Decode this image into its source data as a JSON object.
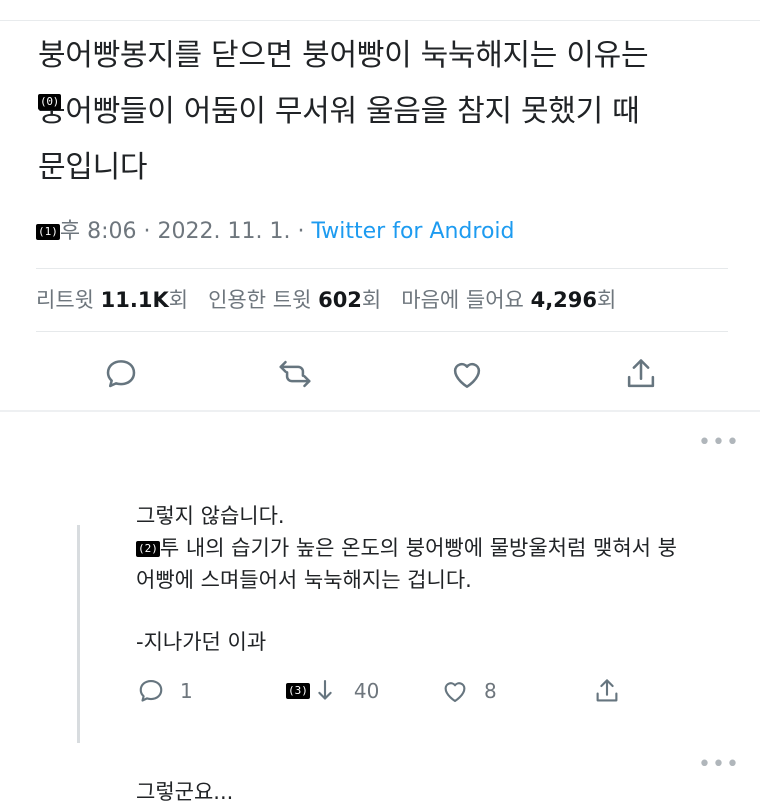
{
  "tweet": {
    "lines": [
      "붕어빵봉지를 닫으면 붕어빵이 눅눅해지는 이유는",
      "붕어빵들이 어둠이 무서워 울음을 참지 못했기 때",
      "문입니다"
    ],
    "marker0": "(0)",
    "marker1": "(1)",
    "time": "후 8:06",
    "date": "2022. 11. 1.",
    "via": "Twitter for Android",
    "stats": {
      "retweet_label": "리트윗",
      "retweet_count": "11.1K",
      "retweet_suffix": "회",
      "quote_label": "인용한 트윗",
      "quote_count": "602",
      "quote_suffix": "회",
      "like_label": "마음에 들어요",
      "like_count": "4,296",
      "like_suffix": "회"
    }
  },
  "actions": {
    "icons": [
      "reply-icon",
      "retweet-icon",
      "like-icon",
      "share-icon"
    ]
  },
  "reply": {
    "line1": "그렇지 않습니다.",
    "marker2": "(2)",
    "line2": "투 내의 습기가 높은 온도의 붕어빵에 물방울처럼 맺혀서 붕",
    "line3": "어빵에 스며들어서 눅눅해지는 겁니다.",
    "line4": "-지나가던 이과",
    "reply_count": "1",
    "marker3": "(3)",
    "retweet_count": "40",
    "like_count": "8"
  },
  "next": {
    "text": "그렇군요..."
  },
  "more_label": "•••"
}
